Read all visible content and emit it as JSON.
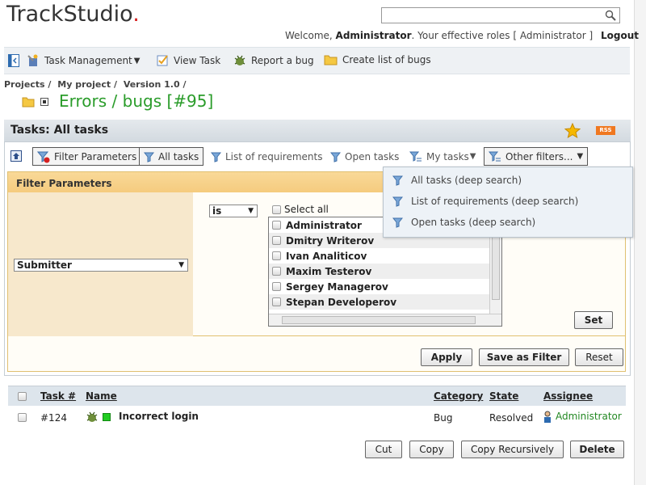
{
  "header": {
    "logo_main": "TrackStudio",
    "logo_dot": ".",
    "welcome_prefix": "Welcome,",
    "user": "Administrator",
    "roles_text": ". Your effective roles",
    "role": "[ Administrator ]",
    "logout": "Logout",
    "search": {
      "value": "",
      "placeholder": ""
    }
  },
  "toolbar": {
    "task_management": "Task Management",
    "view_task": "View Task",
    "report_bug": "Report a bug",
    "create_list": "Create list of bugs"
  },
  "breadcrumb": [
    "Projects /",
    "My project /",
    "Version 1.0 /"
  ],
  "page_title": "Errors / bugs  [#95]",
  "panel": {
    "title": "Tasks: All tasks",
    "rss": "RSS"
  },
  "filter_tabs": {
    "filter_parameters": "Filter Parameters",
    "all_tasks": "All tasks",
    "list_requirements": "List of requirements",
    "open_tasks": "Open tasks",
    "my_tasks": "My tasks",
    "other_filters": "Other filters..."
  },
  "filter": {
    "heading": "Filter Parameters",
    "field": "Submitter",
    "operator": "is",
    "select_all": "Select all",
    "users": [
      "Administrator",
      "Dmitry Writerov",
      "Ivan Analiticov",
      "Maxim Testerov",
      "Sergey Managerov",
      "Stepan Developerov"
    ],
    "set": "Set",
    "apply": "Apply",
    "save_as_filter": "Save as Filter",
    "reset": "Reset"
  },
  "menu": [
    "All tasks (deep search)",
    "List of requirements (deep search)",
    "Open tasks (deep search)"
  ],
  "table": {
    "headers": {
      "task_no": "Task #",
      "name": "Name",
      "category": "Category",
      "state": "State",
      "assignee": "Assignee"
    },
    "rows": [
      {
        "task_no": "#124",
        "name": "Incorrect login",
        "category": "Bug",
        "state": "Resolved",
        "assignee": "Administrator"
      }
    ]
  },
  "actions": {
    "cut": "Cut",
    "copy": "Copy",
    "copy_recursively": "Copy Recursively",
    "delete": "Delete"
  },
  "colors": {
    "title_green": "#2a9c2a",
    "filter_orange": "#f5cb7e",
    "accent_blue": "#2d6bb0"
  }
}
